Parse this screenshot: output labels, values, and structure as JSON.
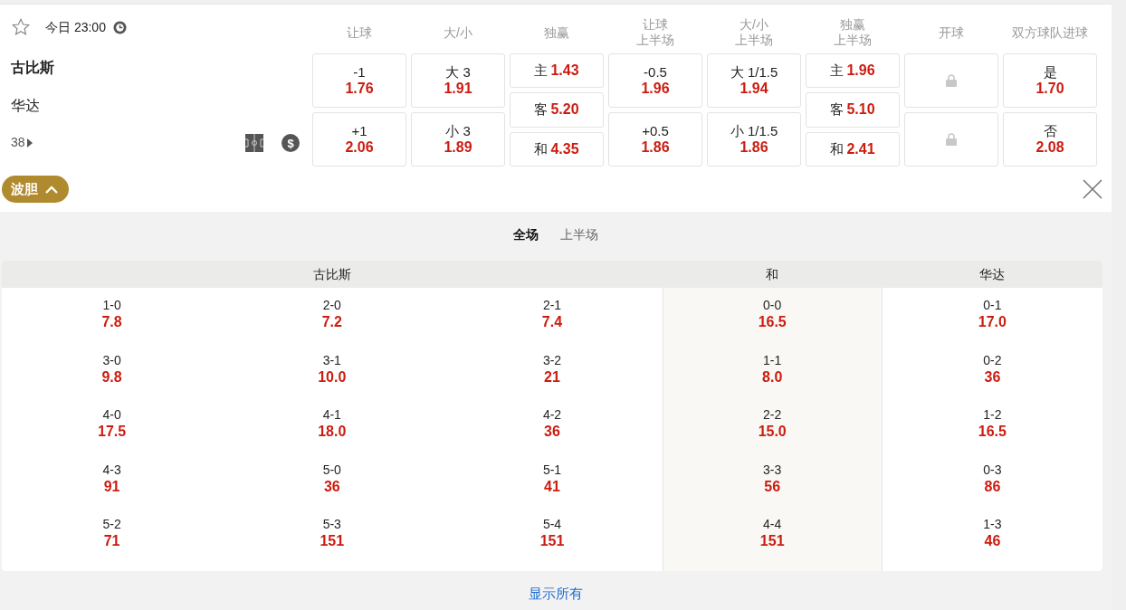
{
  "match": {
    "favorite": false,
    "time": "今日 23:00",
    "home": "古比斯",
    "away": "华达",
    "more_count": "38",
    "odds_symbol": "$"
  },
  "markets": [
    {
      "header": [
        "让球"
      ],
      "kind": "stacked",
      "selections": [
        {
          "label": "-1",
          "odds": "1.76"
        },
        {
          "label": "+1",
          "odds": "2.06"
        }
      ]
    },
    {
      "header": [
        "大/小"
      ],
      "kind": "stacked",
      "selections": [
        {
          "label": "大 3",
          "odds": "1.91"
        },
        {
          "label": "小 3",
          "odds": "1.89"
        }
      ]
    },
    {
      "header": [
        "独赢"
      ],
      "kind": "inline",
      "selections": [
        {
          "label": "主",
          "odds": "1.43"
        },
        {
          "label": "客",
          "odds": "5.20"
        },
        {
          "label": "和",
          "odds": "4.35"
        }
      ]
    },
    {
      "header": [
        "让球",
        "上半场"
      ],
      "kind": "stacked",
      "selections": [
        {
          "label": "-0.5",
          "odds": "1.96"
        },
        {
          "label": "+0.5",
          "odds": "1.86"
        }
      ]
    },
    {
      "header": [
        "大/小",
        "上半场"
      ],
      "kind": "stacked",
      "selections": [
        {
          "label": "大 1/1.5",
          "odds": "1.94"
        },
        {
          "label": "小 1/1.5",
          "odds": "1.86"
        }
      ]
    },
    {
      "header": [
        "独赢",
        "上半场"
      ],
      "kind": "inline",
      "selections": [
        {
          "label": "主",
          "odds": "1.96"
        },
        {
          "label": "客",
          "odds": "5.10"
        },
        {
          "label": "和",
          "odds": "2.41"
        }
      ]
    },
    {
      "header": [
        "开球"
      ],
      "kind": "locked",
      "selections": [
        {
          "locked": true
        },
        {
          "locked": true
        }
      ]
    },
    {
      "header": [
        "双方球队进球"
      ],
      "kind": "stacked",
      "selections": [
        {
          "label": "是",
          "odds": "1.70"
        },
        {
          "label": "否",
          "odds": "2.08"
        }
      ]
    }
  ],
  "correct_score": {
    "button": "波胆",
    "expanded": true,
    "tabs": [
      {
        "label": "全场",
        "selected": true
      },
      {
        "label": "上半场",
        "selected": false
      }
    ],
    "groups": [
      {
        "title": "古比斯",
        "kind": "home",
        "columns": [
          [
            {
              "score": "1-0",
              "odds": "7.8"
            },
            {
              "score": "3-0",
              "odds": "9.8"
            },
            {
              "score": "4-0",
              "odds": "17.5"
            },
            {
              "score": "4-3",
              "odds": "91"
            },
            {
              "score": "5-2",
              "odds": "71"
            }
          ],
          [
            {
              "score": "2-0",
              "odds": "7.2"
            },
            {
              "score": "3-1",
              "odds": "10.0"
            },
            {
              "score": "4-1",
              "odds": "18.0"
            },
            {
              "score": "5-0",
              "odds": "36"
            },
            {
              "score": "5-3",
              "odds": "151"
            }
          ],
          [
            {
              "score": "2-1",
              "odds": "7.4"
            },
            {
              "score": "3-2",
              "odds": "21"
            },
            {
              "score": "4-2",
              "odds": "36"
            },
            {
              "score": "5-1",
              "odds": "41"
            },
            {
              "score": "5-4",
              "odds": "151"
            }
          ]
        ]
      },
      {
        "title": "和",
        "kind": "draw",
        "columns": [
          [
            {
              "score": "0-0",
              "odds": "16.5"
            },
            {
              "score": "1-1",
              "odds": "8.0"
            },
            {
              "score": "2-2",
              "odds": "15.0"
            },
            {
              "score": "3-3",
              "odds": "56"
            },
            {
              "score": "4-4",
              "odds": "151"
            }
          ]
        ]
      },
      {
        "title": "华达",
        "kind": "away",
        "columns": [
          [
            {
              "score": "0-1",
              "odds": "17.0"
            },
            {
              "score": "0-2",
              "odds": "36"
            },
            {
              "score": "1-2",
              "odds": "16.5"
            },
            {
              "score": "0-3",
              "odds": "86"
            },
            {
              "score": "1-3",
              "odds": "46"
            }
          ]
        ]
      }
    ],
    "show_all": "显示所有"
  }
}
